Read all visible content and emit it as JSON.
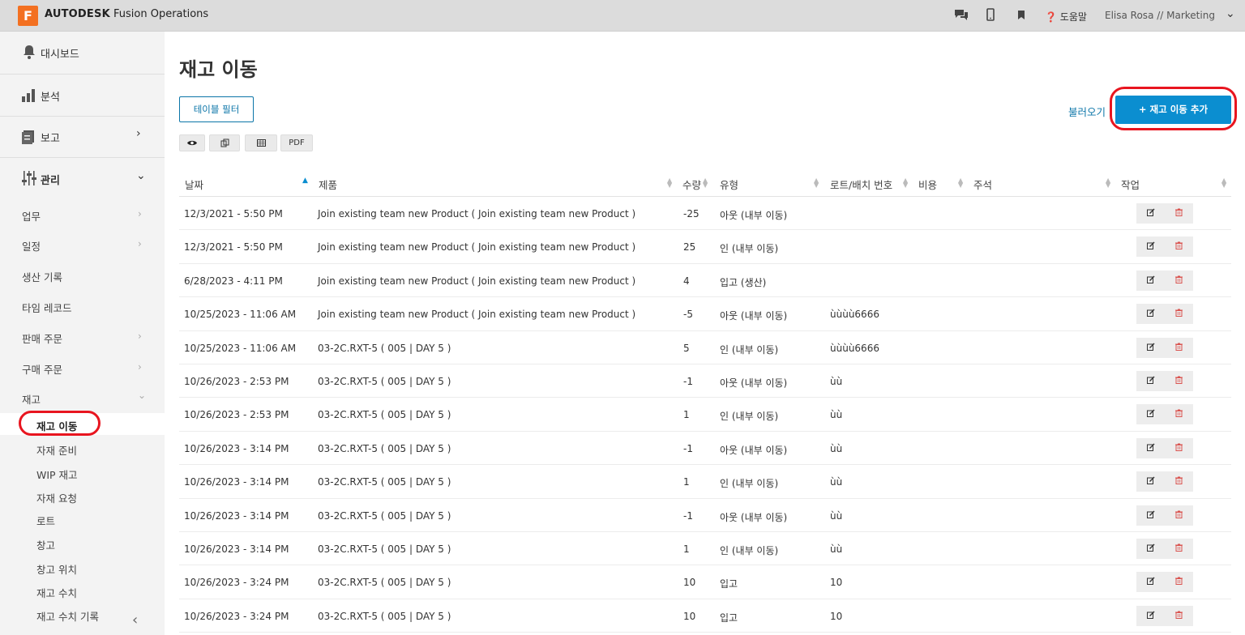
{
  "app": {
    "logo_letter": "F",
    "brand": "AUTODESK",
    "product": "Fusion Operations",
    "help_label": "도움말",
    "user_label": "Elisa Rosa // Marketing"
  },
  "sidebar": {
    "main": [
      {
        "label": "대시보드"
      },
      {
        "label": "분석"
      },
      {
        "label": "보고"
      },
      {
        "label": "관리"
      }
    ],
    "sub": [
      {
        "label": "업무"
      },
      {
        "label": "일정"
      },
      {
        "label": "생산 기록"
      },
      {
        "label": "타임 레코드"
      },
      {
        "label": "판매 주문"
      },
      {
        "label": "구매 주문"
      },
      {
        "label": "재고"
      }
    ],
    "children": [
      {
        "label": "재고 이동"
      },
      {
        "label": "자재 준비"
      },
      {
        "label": "WIP 재고"
      },
      {
        "label": "자재 요청"
      },
      {
        "label": "로트"
      },
      {
        "label": "창고"
      },
      {
        "label": "창고 위치"
      },
      {
        "label": "재고 수치"
      },
      {
        "label": "재고 수치 기록"
      }
    ]
  },
  "main": {
    "title": "재고 이동",
    "filter_button": "테이블 필터",
    "pdf_label": "PDF",
    "import_link": "불러오기",
    "add_button": "+ 재고 이동 추가"
  },
  "table": {
    "headers": [
      "날짜",
      "제품",
      "수량",
      "유형",
      "로트/배치 번호",
      "비용",
      "주석",
      "작업"
    ],
    "rows": [
      {
        "date": "12/3/2021 - 5:50 PM",
        "product": "Join existing team new Product ( Join existing team new Product )",
        "qty": "-25",
        "type": "아웃 (내부 이동)",
        "lot": "",
        "cost": "",
        "note": ""
      },
      {
        "date": "12/3/2021 - 5:50 PM",
        "product": "Join existing team new Product ( Join existing team new Product )",
        "qty": "25",
        "type": "인 (내부 이동)",
        "lot": "",
        "cost": "",
        "note": ""
      },
      {
        "date": "6/28/2023 - 4:11 PM",
        "product": "Join existing team new Product ( Join existing team new Product )",
        "qty": "4",
        "type": "입고 (생산)",
        "lot": "",
        "cost": "",
        "note": ""
      },
      {
        "date": "10/25/2023 - 11:06 AM",
        "product": "Join existing team new Product ( Join existing team new Product )",
        "qty": "-5",
        "type": "아웃 (내부 이동)",
        "lot": "ùùùù6666",
        "cost": "",
        "note": ""
      },
      {
        "date": "10/25/2023 - 11:06 AM",
        "product": "03-2C.RXT-5 ( 005 | DAY 5 )",
        "qty": "5",
        "type": "인 (내부 이동)",
        "lot": "ùùùù6666",
        "cost": "",
        "note": ""
      },
      {
        "date": "10/26/2023 - 2:53 PM",
        "product": "03-2C.RXT-5 ( 005 | DAY 5 )",
        "qty": "-1",
        "type": "아웃 (내부 이동)",
        "lot": "ùù",
        "cost": "",
        "note": ""
      },
      {
        "date": "10/26/2023 - 2:53 PM",
        "product": "03-2C.RXT-5 ( 005 | DAY 5 )",
        "qty": "1",
        "type": "인 (내부 이동)",
        "lot": "ùù",
        "cost": "",
        "note": ""
      },
      {
        "date": "10/26/2023 - 3:14 PM",
        "product": "03-2C.RXT-5 ( 005 | DAY 5 )",
        "qty": "-1",
        "type": "아웃 (내부 이동)",
        "lot": "ùù",
        "cost": "",
        "note": ""
      },
      {
        "date": "10/26/2023 - 3:14 PM",
        "product": "03-2C.RXT-5 ( 005 | DAY 5 )",
        "qty": "1",
        "type": "인 (내부 이동)",
        "lot": "ùù",
        "cost": "",
        "note": ""
      },
      {
        "date": "10/26/2023 - 3:14 PM",
        "product": "03-2C.RXT-5 ( 005 | DAY 5 )",
        "qty": "-1",
        "type": "아웃 (내부 이동)",
        "lot": "ùù",
        "cost": "",
        "note": ""
      },
      {
        "date": "10/26/2023 - 3:14 PM",
        "product": "03-2C.RXT-5 ( 005 | DAY 5 )",
        "qty": "1",
        "type": "인 (내부 이동)",
        "lot": "ùù",
        "cost": "",
        "note": ""
      },
      {
        "date": "10/26/2023 - 3:24 PM",
        "product": "03-2C.RXT-5 ( 005 | DAY 5 )",
        "qty": "10",
        "type": "입고",
        "lot": "10",
        "cost": "",
        "note": ""
      },
      {
        "date": "10/26/2023 - 3:24 PM",
        "product": "03-2C.RXT-5 ( 005 | DAY 5 )",
        "qty": "10",
        "type": "입고",
        "lot": "10",
        "cost": "",
        "note": ""
      }
    ]
  }
}
